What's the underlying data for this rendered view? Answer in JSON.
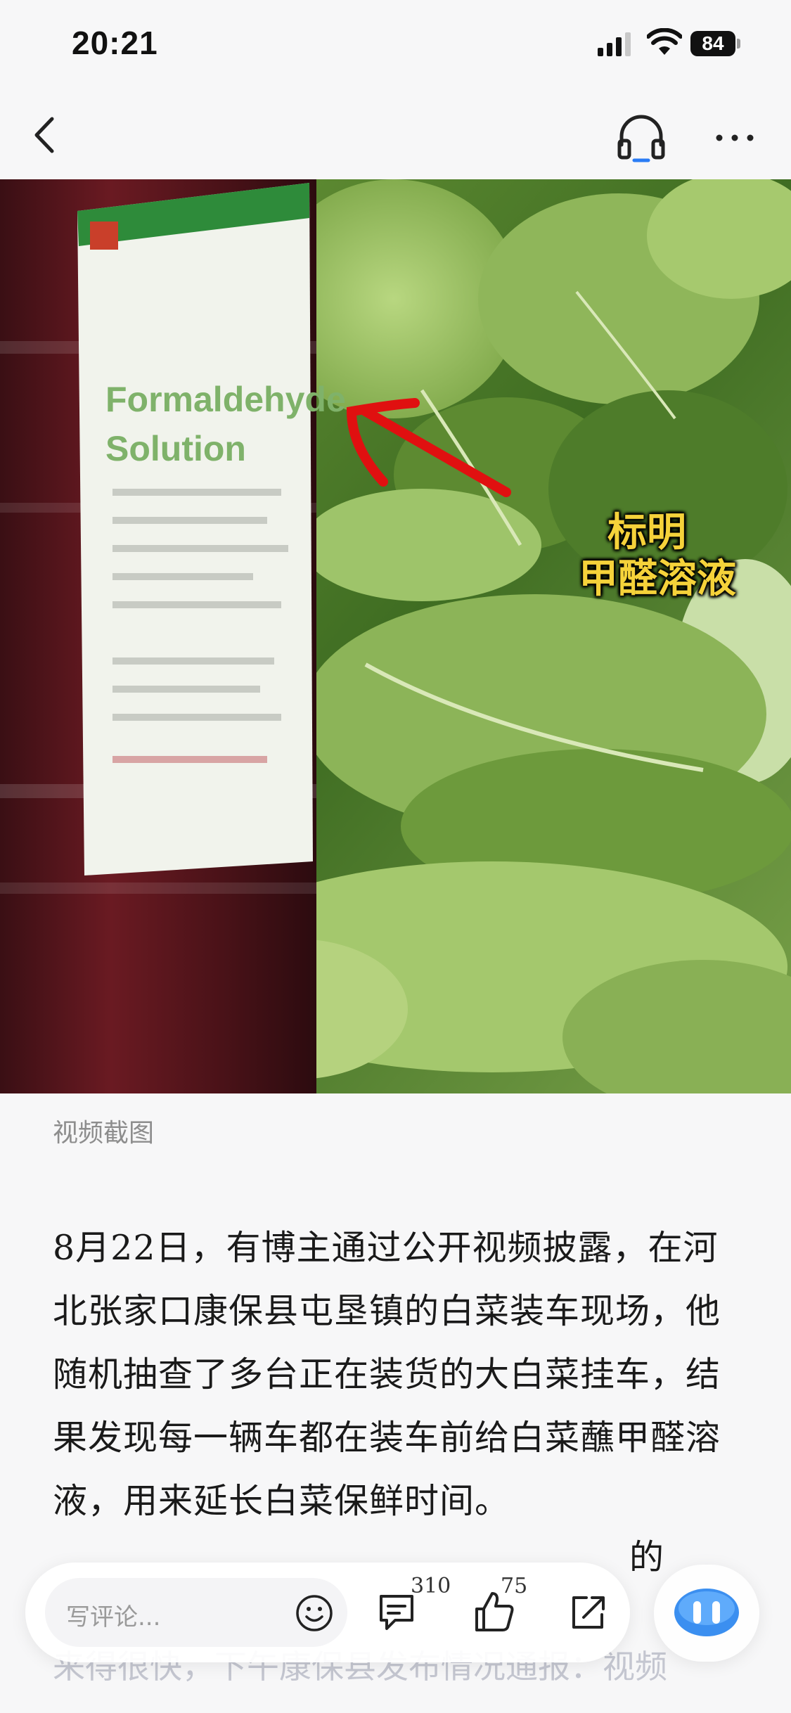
{
  "status_bar": {
    "time": "20:21",
    "battery": "84",
    "icons": [
      "signal-icon",
      "wifi-icon",
      "battery-icon"
    ]
  },
  "nav": {
    "icons": [
      "back-icon",
      "headphone-icon",
      "more-icon"
    ]
  },
  "image": {
    "label_line1": "Formaldehyde",
    "label_line2": "Solution",
    "overlay_line1": "标明",
    "overlay_line2": "甲醛溶液"
  },
  "caption": "视频截图",
  "article": {
    "paragraph1": "8月22日，有博主通过公开视频披露，在河北张家口康保县屯垦镇的白菜装车现场，他随机抽查了多台正在装货的大白菜挂车，结果发现每一辆车都在装车前给白菜蘸甲醛溶液，用来延长白菜保鲜时间。",
    "paragraph2_visible_tail": "的",
    "paragraph2_faded": "来得很快，下午康保县发布情况通报：视频"
  },
  "bottom_bar": {
    "comment_placeholder": "写评论...",
    "comment_count": "310",
    "like_count": "75",
    "icons": [
      "emoji-icon",
      "comment-icon",
      "like-icon",
      "share-icon",
      "ai-assistant-icon"
    ]
  },
  "colors": {
    "overlay_text": "#f5d23a",
    "arrow": "#e01010",
    "background": "#f7f7f8",
    "assistant_blue": "#3b8ff0"
  }
}
